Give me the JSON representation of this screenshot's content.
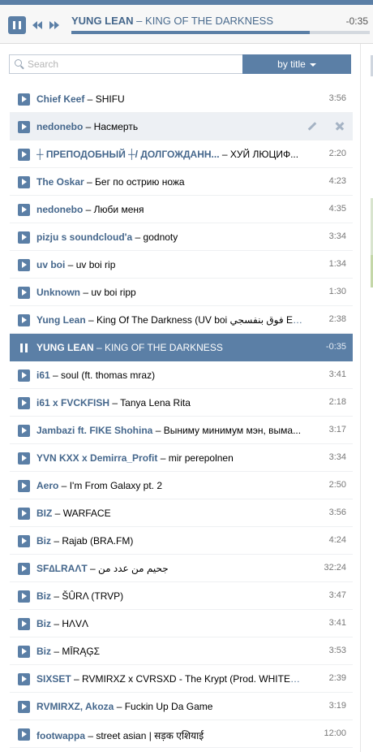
{
  "player": {
    "artist": "YUNG LEAN",
    "separator": " – ",
    "title": "KING OF THE DARKNESS",
    "time": "-0:35",
    "progress": 0.8
  },
  "search": {
    "placeholder": "Search",
    "value": ""
  },
  "sort": {
    "label": "by title"
  },
  "colors": {
    "accent": "#5b7fa6",
    "link": "#45678c",
    "hover_row": "#edf0f4"
  },
  "tracks": [
    {
      "artist": "Chief Keef",
      "title": "SHIFU",
      "duration": "3:56"
    },
    {
      "artist": "nedonebo",
      "title": "Насмерть",
      "duration": "",
      "state": "hover"
    },
    {
      "artist": "┼ ПРЕПОДОБНЫЙ ┼/ ДОЛГОЖДАНН...",
      "title": "ХУЙ ЛЮЦИФ...",
      "duration": "2:20"
    },
    {
      "artist": "The Oskar",
      "title": "Бег по острию ножа",
      "duration": "4:23"
    },
    {
      "artist": "nedonebo",
      "title": "Люби меня",
      "duration": "4:35"
    },
    {
      "artist": "pizju s soundcloud'a",
      "title": "godnoty",
      "duration": "3:34"
    },
    {
      "artist": "uv boi",
      "title": "uv boi rip",
      "duration": "1:34"
    },
    {
      "artist": "Unknown",
      "title": "uv boi ripp",
      "duration": "1:30"
    },
    {
      "artist": "Yung Lean",
      "title": "King Of The Darkness (UV boi فوق بنفسجي Edit)",
      "duration": "2:38"
    },
    {
      "artist": "YUNG LEAN",
      "title": "KING OF THE DARKNESS",
      "duration": "-0:35",
      "state": "active"
    },
    {
      "artist": "i61",
      "title": "soul (ft. thomas mraz)",
      "duration": "3:41"
    },
    {
      "artist": "i61 x FVCKFISH",
      "title": "Tanya Lena Rita",
      "duration": "2:18"
    },
    {
      "artist": "Jambazi ft. FIKE Shohina",
      "title": "Выниму минимум мэн, выма...",
      "duration": "3:17"
    },
    {
      "artist": "YVN KXX x Demirra_Profit",
      "title": "mir perepolnen",
      "duration": "3:34"
    },
    {
      "artist": "Aero",
      "title": "I'm From Galaxy pt. 2",
      "duration": "2:50"
    },
    {
      "artist": "BIZ",
      "title": "WARFACE",
      "duration": "3:56"
    },
    {
      "artist": "Biz",
      "title": "Rajab (BRA.FM)",
      "duration": "4:24"
    },
    {
      "artist": "SF∆LRAΛT",
      "title": "جحيم من عدد من",
      "duration": "32:24"
    },
    {
      "artist": "Biz",
      "title": "ŠÛRΛ (TRVP)",
      "duration": "3:47"
    },
    {
      "artist": "Biz",
      "title": "HΛVΛ",
      "duration": "3:41"
    },
    {
      "artist": "Biz",
      "title": "MĪRĄĢΣ",
      "duration": "3:53"
    },
    {
      "artist": "SIXSET",
      "title": "RVMIRXZ x CVRSXD - The Krypt (Prod. WHITEG...",
      "duration": "2:39"
    },
    {
      "artist": "RVMIRXZ, Akoza",
      "title": "Fuckin Up Da Game",
      "duration": "3:19"
    },
    {
      "artist": "footwappa",
      "title": "street asian | सड़क एशियाई",
      "duration": "12:00"
    }
  ]
}
